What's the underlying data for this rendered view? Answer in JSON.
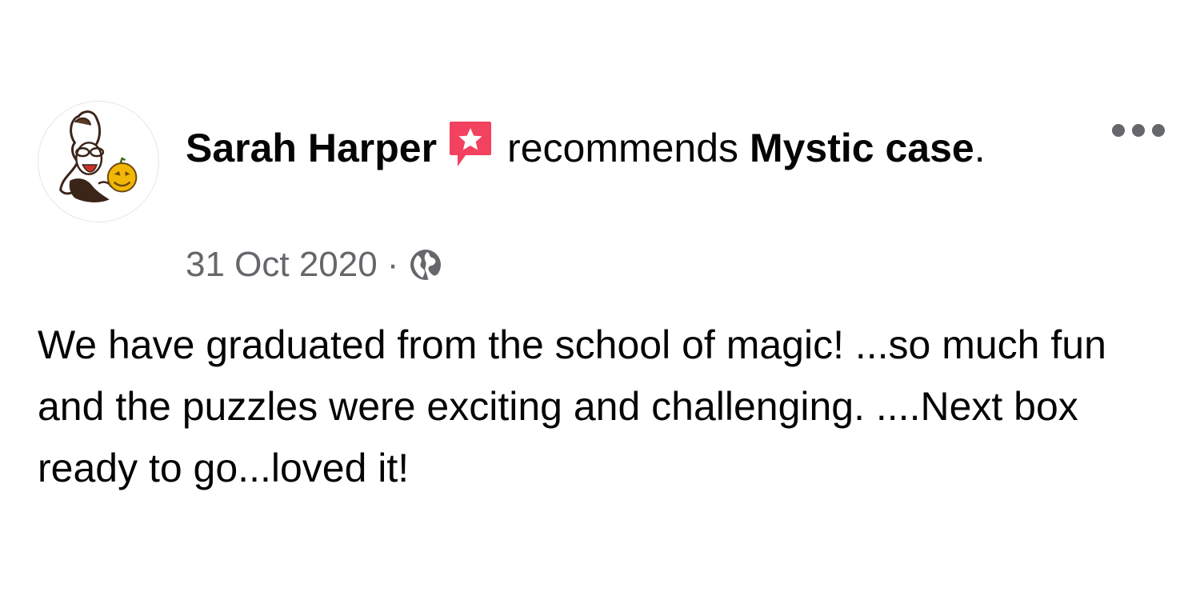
{
  "post": {
    "author": "Sarah Harper",
    "action": "recommends",
    "page_name": "Mystic case",
    "page_suffix": ".",
    "date": "31 Oct 2020",
    "separator": "·",
    "privacy_icon": "globe-icon",
    "recommend_icon": "recommendation-star-icon",
    "more_icon": "more-options-icon",
    "body": "We have graduated from the school of magic! ...so much fun and the puzzles were exciting and challenging. ....Next box ready to go...loved it!"
  },
  "colors": {
    "text_primary": "#050505",
    "text_secondary": "#65676b",
    "recommend_badge": "#f3425f"
  }
}
